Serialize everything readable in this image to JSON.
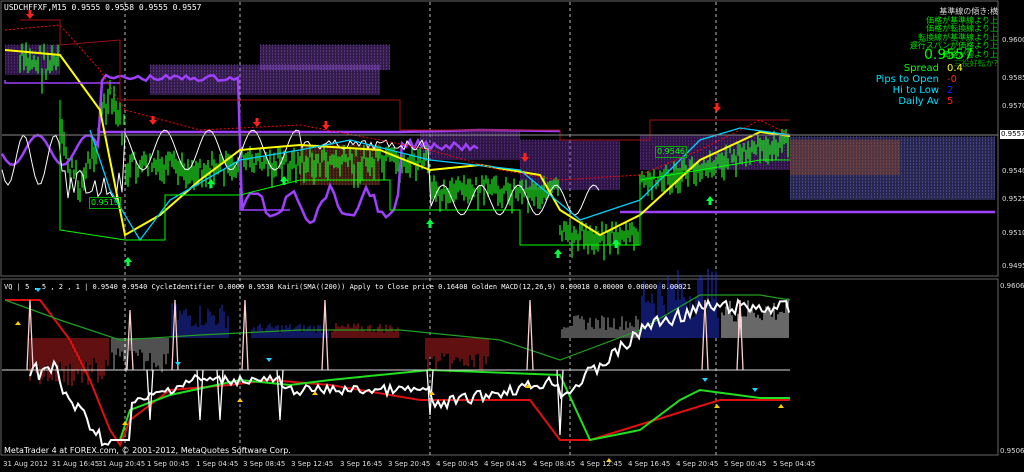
{
  "main_chart": {
    "title": "USDCHFFXF,M15",
    "ohlc": "0.9555 0.9558 0.9555 0.9557",
    "current_price": "0.9557",
    "price_ticks": [
      "0.9600",
      "0.9585",
      "0.9570",
      "0.9557",
      "0.9540",
      "0.9525",
      "0.9510",
      "0.9495"
    ],
    "cursor_tag": "0.9557",
    "box_label_1": "0.9519",
    "box_label_2": "0.9546"
  },
  "info_panel": {
    "header": "基準線の傾き:横",
    "lines": [
      "価格が基準線より上",
      "価格が転換線より上",
      "転換線が基準線より上",
      "遅行スパンが価格より上",
      "価格が雲より上",
      "三役好転か?"
    ],
    "big_price": "0.9557",
    "stats": [
      {
        "label": "Spread",
        "value": "0.4",
        "label_color": "#00ff00",
        "value_color": "#ffff00"
      },
      {
        "label": "Pips to Open",
        "value": "-0",
        "label_color": "#00e0ff",
        "value_color": "#ff2020"
      },
      {
        "label": "Hi to Low",
        "value": "2",
        "label_color": "#00e0ff",
        "value_color": "#2020ff"
      },
      {
        "label": "Daily Av",
        "value": "5",
        "label_color": "#00e0ff",
        "value_color": "#ff2020"
      }
    ]
  },
  "sub_chart": {
    "header": "VQ | 5 , 5 , 2 , 1 | 0.9540 0.9540  CycleIdentifier 0.0000 0.9538  Kairi(SMA((200)) Apply to Close price 0.16408  Golden MACD(12,26,9) 0.00018 0.00000 0.00000 0.00021",
    "price_ticks": [
      "0.9606",
      "0.9506"
    ],
    "footer": "MetaTrader 4 at FOREX.com, © 2001-2012, MetaQuotes Software Corp."
  },
  "x_axis": [
    "31 Aug 2012",
    "31 Aug 16:45",
    "31 Aug 20:45",
    "1 Sep 00:45",
    "1 Sep 04:45",
    "3 Sep 08:45",
    "3 Sep 12:45",
    "3 Sep 16:45",
    "3 Sep 20:45",
    "4 Sep 00:45",
    "4 Sep 04:45",
    "4 Sep 08:45",
    "4 Sep 12:45",
    "4 Sep 16:45",
    "4 Sep 20:45",
    "5 Sep 00:45",
    "5 Sep 04:45"
  ],
  "colors": {
    "background": "#000000",
    "green_line": "#00ff00",
    "red_line": "#ff0000",
    "yellow_line": "#ffff00",
    "purple_line": "#a040ff",
    "cyan_line": "#00d0ff",
    "white_line": "#ffffff"
  },
  "icons": [
    "arrow-down-icon",
    "arrow-up-icon"
  ]
}
